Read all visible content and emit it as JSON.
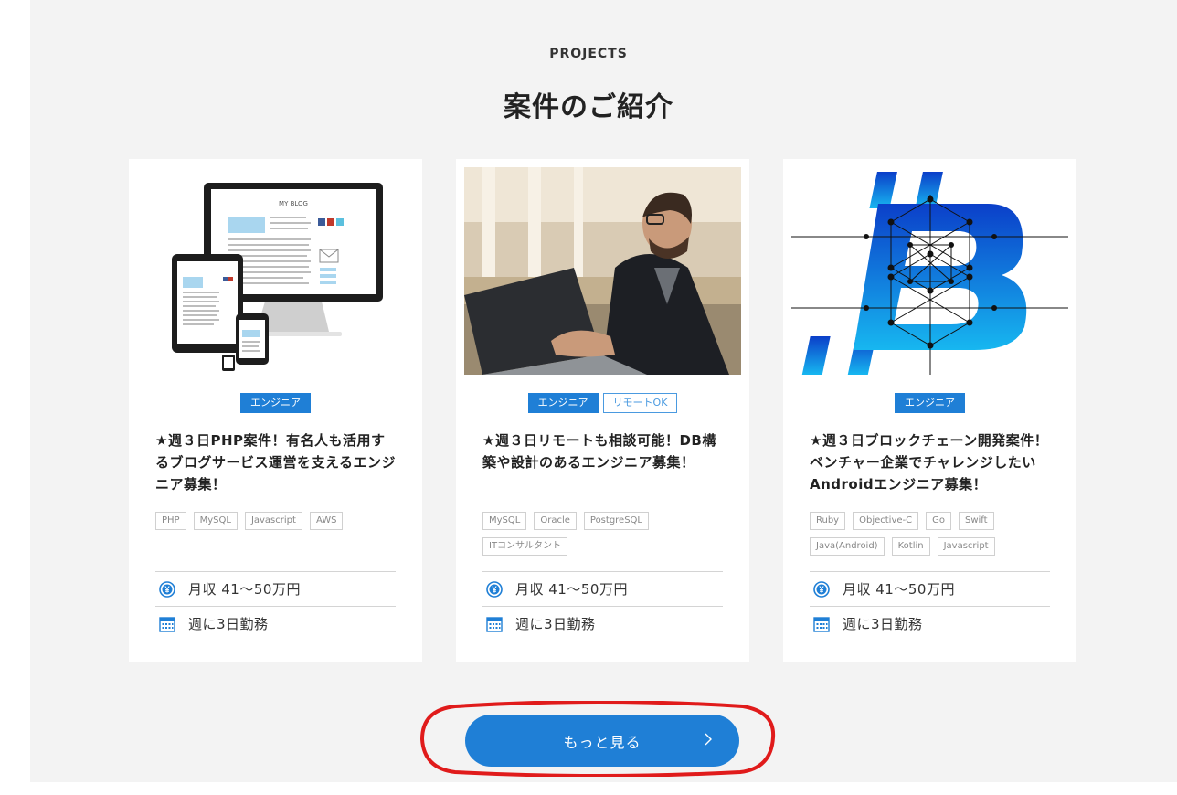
{
  "section": {
    "eyebrow": "PROJECTS",
    "title": "案件のご紹介"
  },
  "cards": [
    {
      "badges": [
        "エンジニア"
      ],
      "title": "★週３日PHP案件！有名人も活用するブログサービス運営を支えるエンジニア募集！",
      "tags": [
        "PHP",
        "MySQL",
        "Javascript",
        "AWS"
      ],
      "salary": "月収 41〜50万円",
      "schedule": "週に3日勤務",
      "image_text": "MY BLOG"
    },
    {
      "badges": [
        "エンジニア",
        "リモートOK"
      ],
      "title": "★週３日リモートも相談可能！DB構築や設計のあるエンジニア募集！",
      "tags": [
        "MySQL",
        "Oracle",
        "PostgreSQL",
        "ITコンサルタント"
      ],
      "salary": "月収 41〜50万円",
      "schedule": "週に3日勤務"
    },
    {
      "badges": [
        "エンジニア"
      ],
      "title": "★週３日ブロックチェーン開発案件！ベンチャー企業でチャレンジしたいAndroidエンジニア募集！",
      "tags": [
        "Ruby",
        "Objective-C",
        "Go",
        "Swift",
        "Java(Android)",
        "Kotlin",
        "Javascript"
      ],
      "salary": "月収 41〜50万円",
      "schedule": "週に3日勤務"
    }
  ],
  "more_button": {
    "label": "もっと見る"
  },
  "colors": {
    "accent": "#1f7fd6",
    "background": "#f3f3f3",
    "annotation": "#e01b1b"
  },
  "icons": {
    "salary": "yen-circle-icon",
    "schedule": "calendar-icon",
    "button": "chevron-right-icon"
  }
}
